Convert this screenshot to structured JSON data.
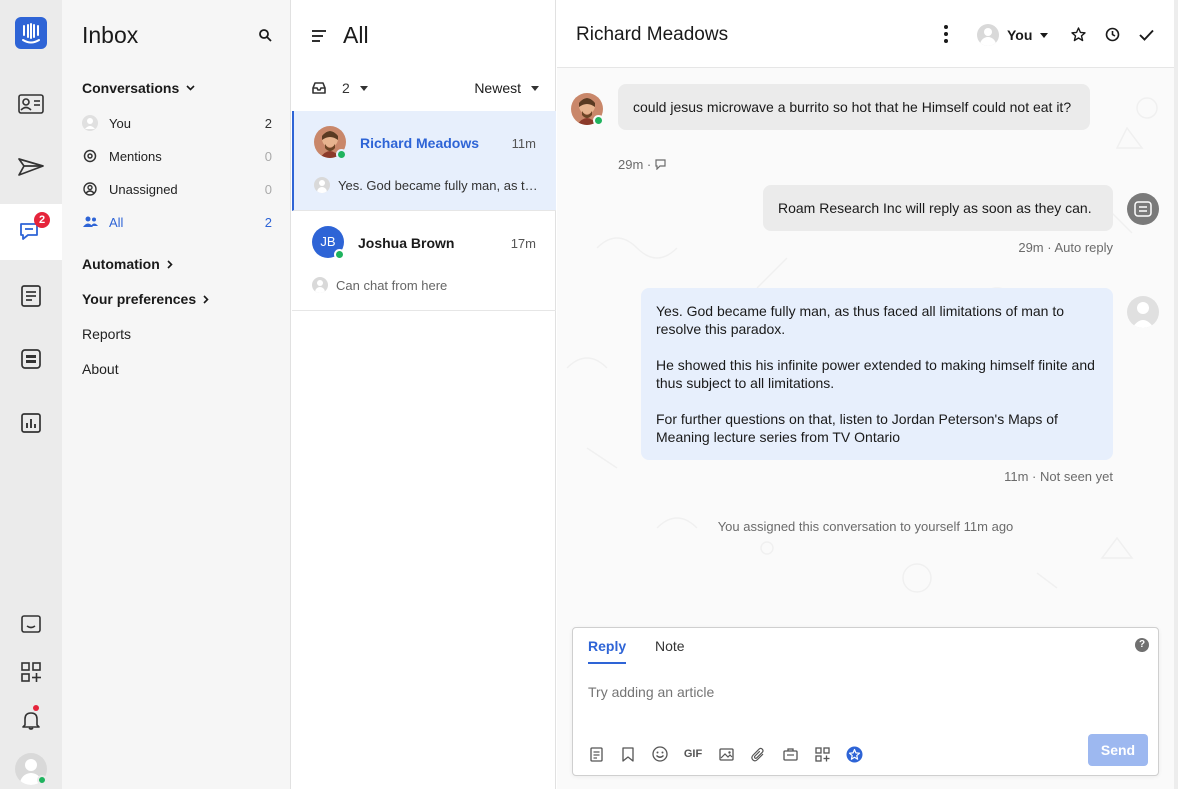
{
  "rail": {
    "badge_count": "2",
    "icons": [
      "intercom-logo-icon",
      "contacts-icon",
      "outbound-icon",
      "inbox-icon",
      "articles-icon",
      "messenger-icon",
      "reports-icon",
      "help-center-icon",
      "apps-icon",
      "notifications-icon",
      "user-avatar-icon"
    ]
  },
  "nav": {
    "title": "Inbox",
    "conversations_label": "Conversations",
    "items": [
      {
        "label": "You",
        "count": "2"
      },
      {
        "label": "Mentions",
        "count": "0"
      },
      {
        "label": "Unassigned",
        "count": "0"
      },
      {
        "label": "All",
        "count": "2"
      }
    ],
    "automation_label": "Automation",
    "preferences_label": "Your preferences",
    "reports_label": "Reports",
    "about_label": "About"
  },
  "list": {
    "title": "All",
    "filter_count": "2",
    "sort_label": "Newest",
    "conversations": [
      {
        "name": "Richard Meadows",
        "time": "11m",
        "preview": "Yes. God became fully man, as thus faced all limitations of man to resolve this paradox."
      },
      {
        "name": "Joshua Brown",
        "initials": "JB",
        "time": "17m",
        "preview": "Can chat from here"
      }
    ]
  },
  "main": {
    "title": "Richard Meadows",
    "assignee": "You",
    "messages": {
      "customer_text": "could jesus microwave a burrito so hot that he Himself could not eat it?",
      "customer_meta": "29m ·",
      "auto_text": "Roam Research Inc will reply as soon as they can.",
      "auto_meta": "29m · Auto reply",
      "reply_p1": "Yes. God became fully man, as thus faced all limitations of man to resolve this paradox.",
      "reply_p2": "He showed this his infinite power extended to making himself finite and thus subject to all limitations.",
      "reply_p3": "For further questions on that, listen to Jordan Peterson's Maps of Meaning lecture series from TV Ontario",
      "reply_meta": "11m · Not seen yet",
      "event": "You assigned this conversation to yourself 11m ago"
    }
  },
  "composer": {
    "tab_reply": "Reply",
    "tab_note": "Note",
    "help": "?",
    "placeholder": "Try adding an article",
    "gif_label": "GIF",
    "send_label": "Send"
  },
  "colors": {
    "accent": "#2e64d6",
    "online": "#1fb35e",
    "badge": "#e5243b",
    "selected_bg": "#e7effc"
  }
}
